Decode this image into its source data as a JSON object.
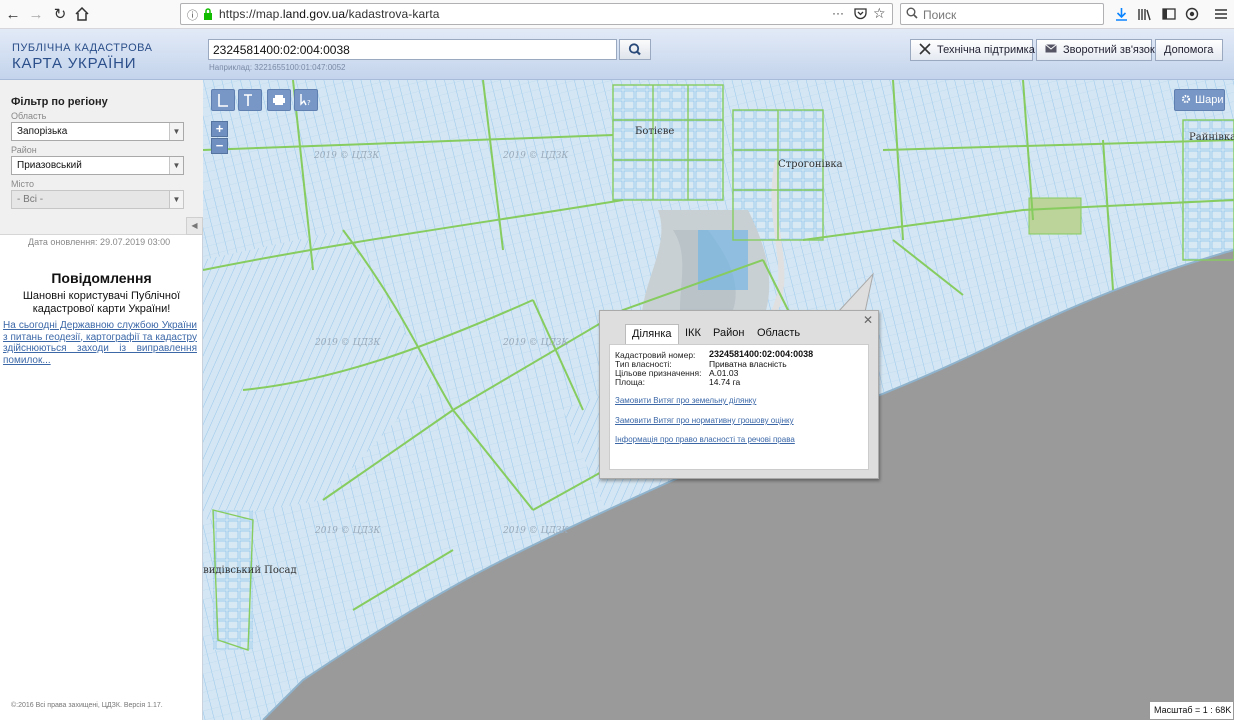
{
  "browser": {
    "url_prefix": "https://map.",
    "url_domain": "land.gov.ua",
    "url_path": "/kadastrova-karta",
    "search_placeholder": "Поиск",
    "more_label": "···"
  },
  "header": {
    "logo_line1": "ПУБЛІЧНА КАДАСТРОВА",
    "logo_line2": "КАРТА УКРАЇНИ",
    "search_value": "2324581400:02:004:0038",
    "example_hint": "Наприклад: 3221655100:01:047:0052",
    "tech_support": "Технічна підтримка",
    "feedback": "Зворотний зв'язок",
    "help": "Допомога"
  },
  "filter": {
    "title": "Фільтр по регіону",
    "oblast_label": "Область",
    "oblast_value": "Запорізька",
    "raion_label": "Район",
    "raion_value": "Приазовський",
    "misto_label": "Місто",
    "misto_value": "- Всі -"
  },
  "sidebar": {
    "update_date": "Дата оновлення: 29.07.2019 03:00",
    "notice_title": "Повідомлення",
    "notice_greeting": "Шановні користувачі Публічної кадастрової карти України!",
    "notice_link": "На сьогодні Державною службою України з питань геодезії, картографії та кадастру здійснюються заходи із виправлення помилок...",
    "copyright": "©:2016 Всі права захищені, ЦДЗК. Версія 1.17."
  },
  "map": {
    "layers_button": "Шари",
    "place_labels": [
      "Ботієве",
      "Строгонівка",
      "Райнівка",
      "Давидівський Посад"
    ],
    "watermark": "2019 © ЦДЗК",
    "scale": "Масштаб = 1 : 68K",
    "colors": {
      "parcel": "#9bcaf0",
      "boundary": "#86cc5f",
      "sea": "#9a9a9a",
      "land": "#d2e5f2"
    }
  },
  "popup": {
    "tabs": [
      "Ділянка",
      "ІКК",
      "Район",
      "Область"
    ],
    "fields": [
      {
        "label": "Кадастровий номер:",
        "value": "2324581400:02:004:0038"
      },
      {
        "label": "Тип власності:",
        "value": "Приватна власність"
      },
      {
        "label": "Цільове призначення:",
        "value": "A.01.03"
      },
      {
        "label": "Площа:",
        "value": "14.74 га"
      }
    ],
    "links": [
      "Замовити Витяг про земельну ділянку",
      "Замовити Витяг про нормативну грошову оцінку",
      "Інформація про право власності та речові права"
    ]
  }
}
